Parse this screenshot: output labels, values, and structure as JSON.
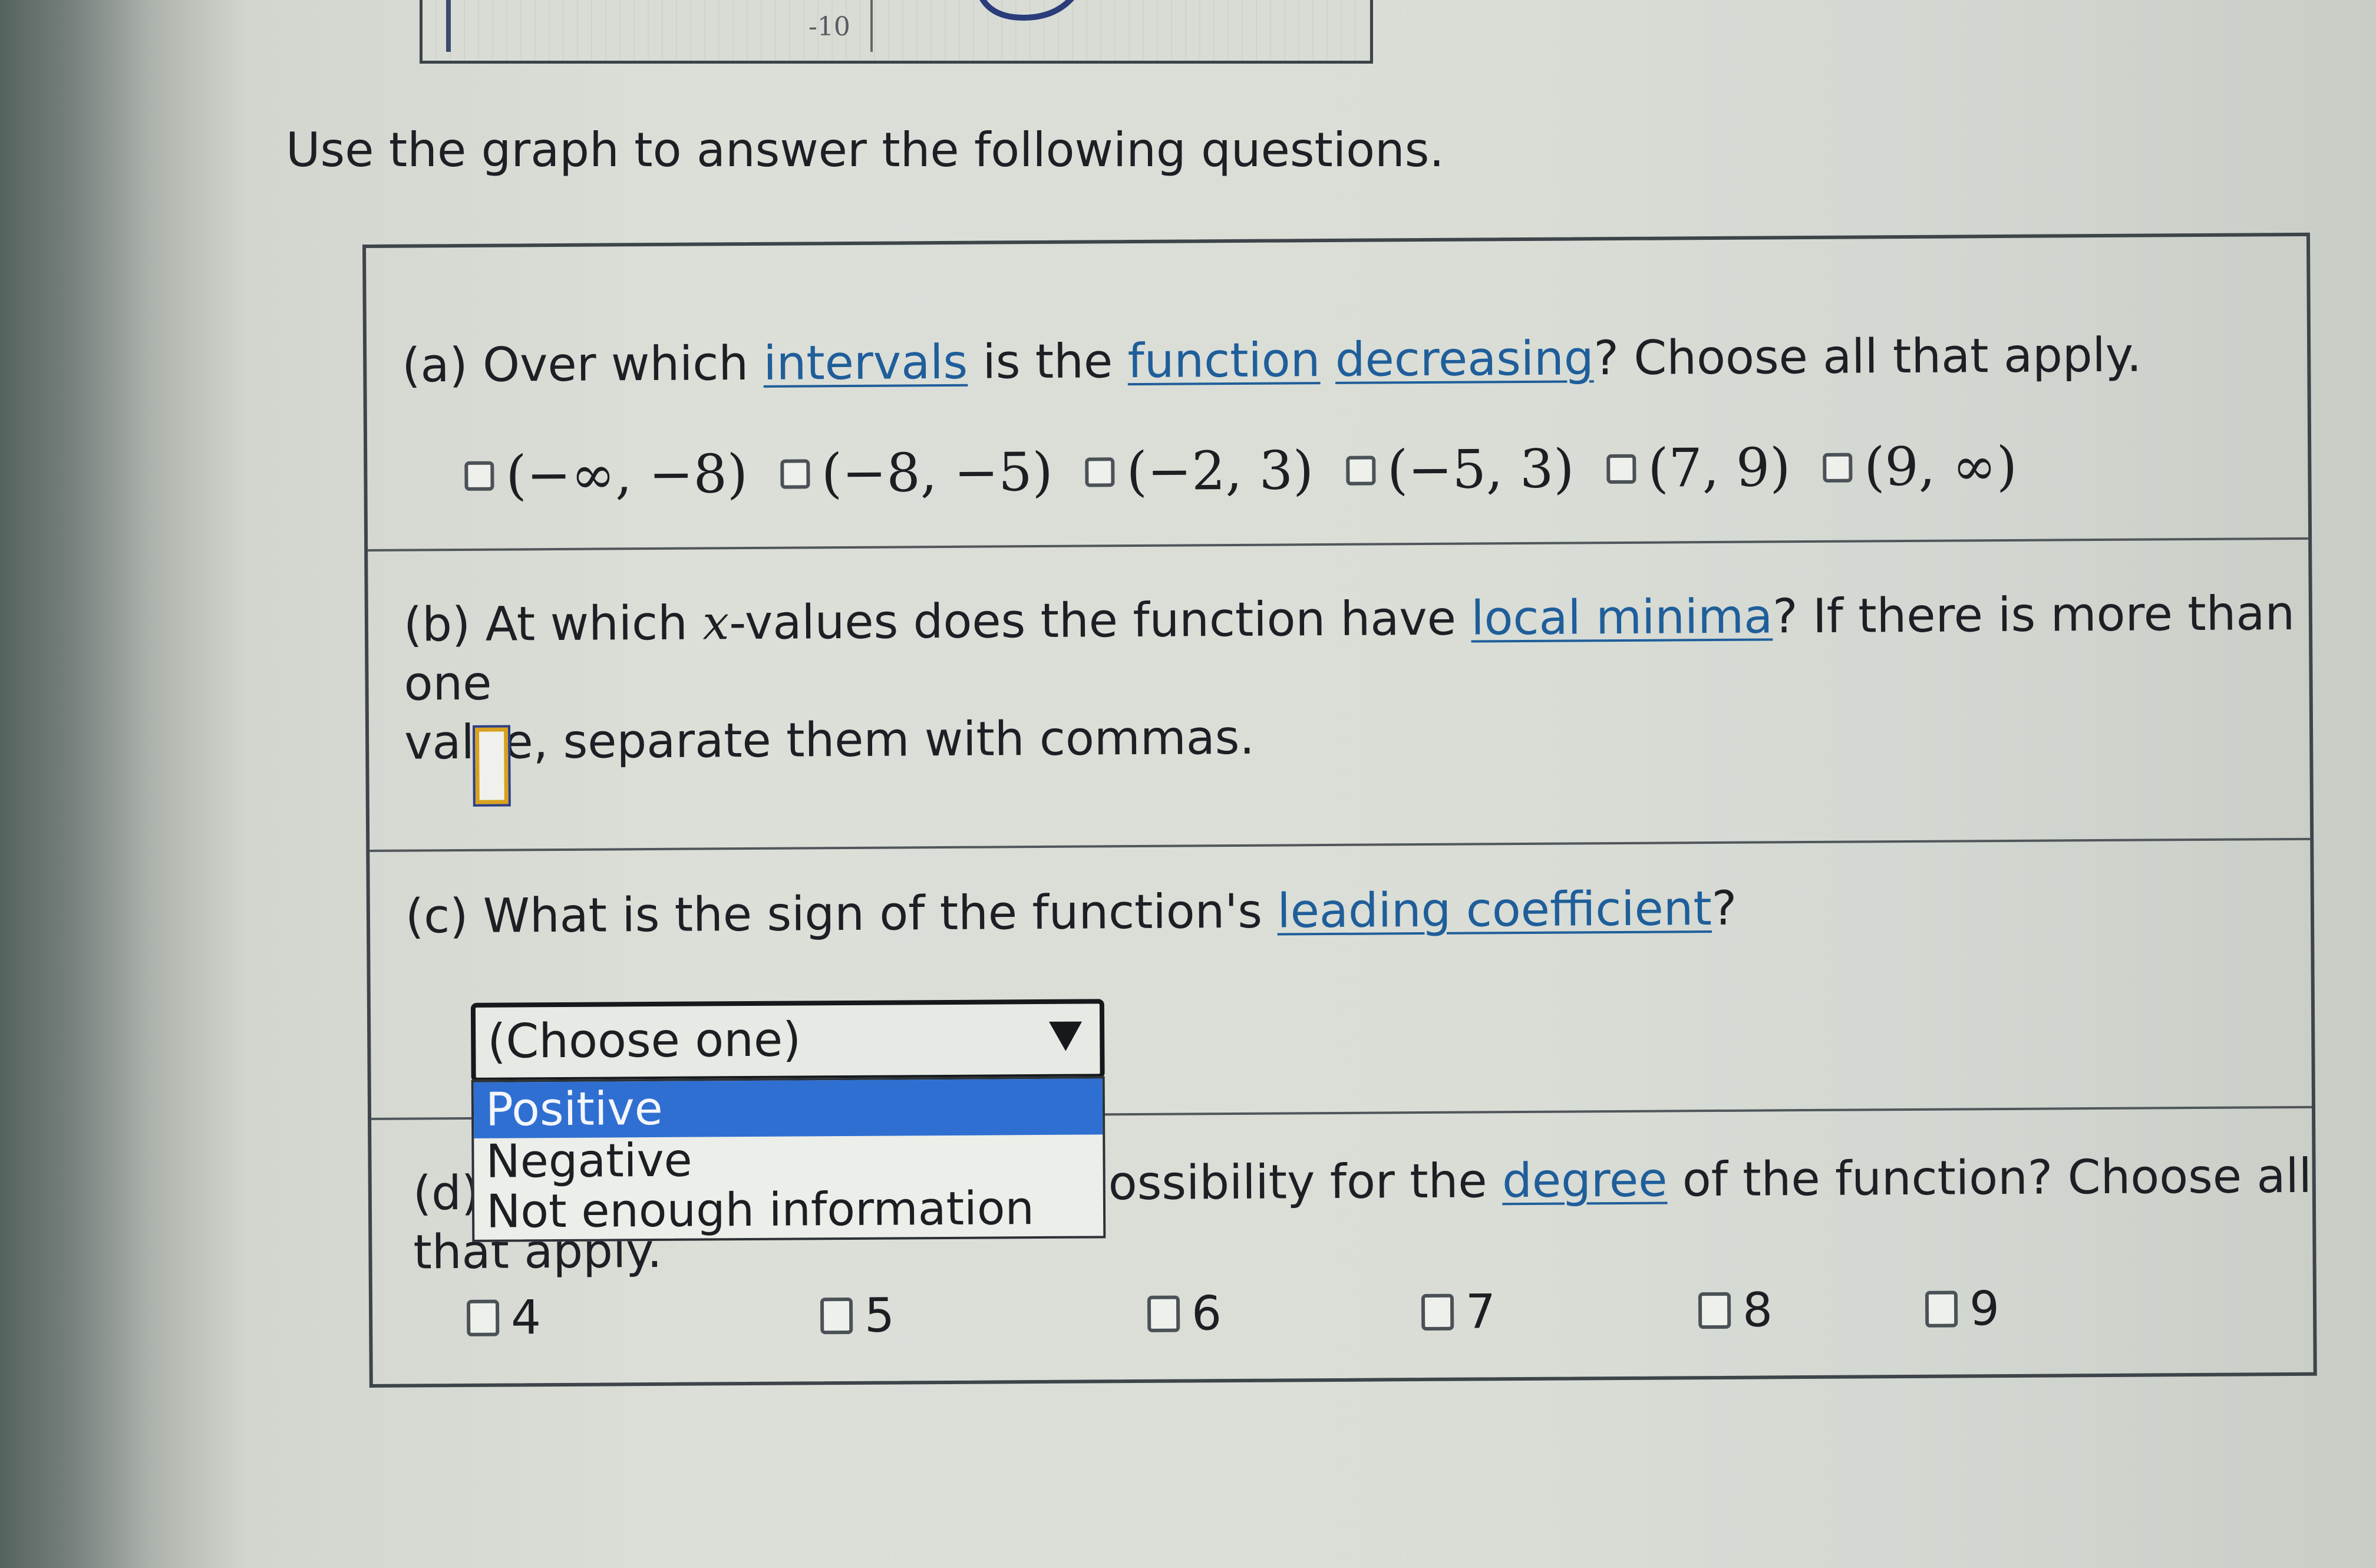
{
  "graph": {
    "tick_label": "-10"
  },
  "instructions": "Use the graph to answer the following questions.",
  "part_a": {
    "prefix": "(a) Over which ",
    "link1": "intervals",
    "mid1": " is the ",
    "link2": "function",
    "mid2": " ",
    "link3": "decreasing",
    "suffix": "? Choose all that apply.",
    "choices": [
      "(−∞, −8)",
      "(−8, −5)",
      "(−2, 3)",
      "(−5, 3)",
      "(7, 9)",
      "(9, ∞)"
    ]
  },
  "part_b": {
    "prefix": "(b) At which ",
    "var": "x",
    "mid": "-values does the function have ",
    "link": "local minima",
    "suffix": "? If there is more than one",
    "line2": "value, separate them with commas.",
    "input_value": ""
  },
  "part_c": {
    "prefix": "(c) What is the sign of the function's ",
    "link": "leading coefficient",
    "suffix": "?",
    "select_value": "(Choose one)",
    "options": [
      "Positive",
      "Negative",
      "Not enough information"
    ]
  },
  "part_d": {
    "prefix": "(d)",
    "visible_text": "ossibility for the ",
    "link": "degree",
    "suffix": " of the function? Choose all",
    "line2": "that apply.",
    "choices": [
      "4",
      "5",
      "6",
      "7",
      "8",
      "9"
    ]
  },
  "colors": {
    "link": "#1f5e9a",
    "highlight": "#2f6fd1",
    "input_border": "#d8a21e"
  }
}
